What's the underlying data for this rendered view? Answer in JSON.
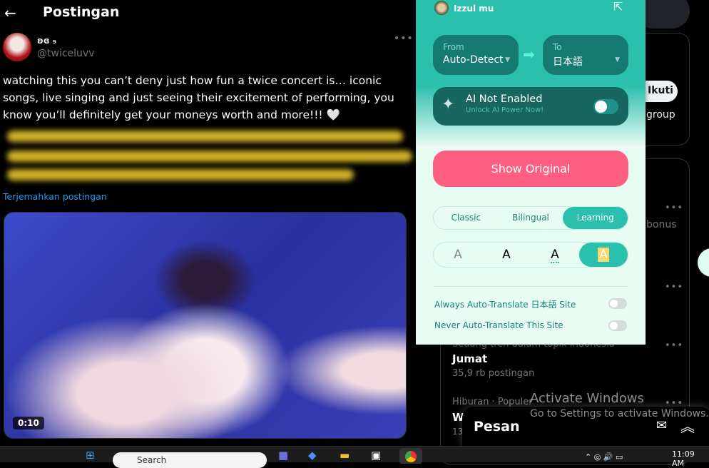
{
  "header": {
    "back_icon": "arrow-left-icon",
    "title": "Postingan"
  },
  "post": {
    "display_name": "ʚɞ ₉",
    "handle": "@twiceluvv",
    "text": "watching this you can’t deny just how fun a twice concert is… iconic songs, live singing and just seeing their excitement of performing, you know you’ll definitely get your moneys worth and more!!! 🤍",
    "translate_link": "Terjemahkan postingan",
    "video_time": "0:10"
  },
  "sidebar": {
    "follow_label": "Ikuti",
    "group_text": "group",
    "bonus_text": "bonus",
    "trends": [
      {
        "category": "Sedang tren dalam topik Indonesia",
        "name": "Jumat",
        "count": "35,9 rb postingan"
      },
      {
        "category": "Hiburan · Populer",
        "name": "W",
        "count": "13,"
      }
    ]
  },
  "messages": {
    "title": "Pesan"
  },
  "watermark": {
    "line1": "Activate Windows",
    "line2": "Go to Settings to activate Windows."
  },
  "taskbar": {
    "search_placeholder": "Search",
    "time": "11:09 AM"
  },
  "popup": {
    "user": "Izzul mu",
    "from_label": "From",
    "from_value": "Auto-Detect",
    "to_label": "To",
    "to_value": "日本語",
    "ai_title": "AI Not Enabled",
    "ai_sub": "Unlock AI Power Now!",
    "ai_enabled": false,
    "show_original": "Show Original",
    "modes": [
      "Classic",
      "Bilingual",
      "Learning"
    ],
    "active_mode": "Learning",
    "style_glyph": "A",
    "option1": "Always Auto-Translate 日本語 Site",
    "option1_on": false,
    "option2": "Never Auto-Translate This Site",
    "option2_on": false,
    "colors": {
      "accent": "#2bbfae",
      "button": "#fe5e7f",
      "highlight": "#f9d96b"
    }
  }
}
